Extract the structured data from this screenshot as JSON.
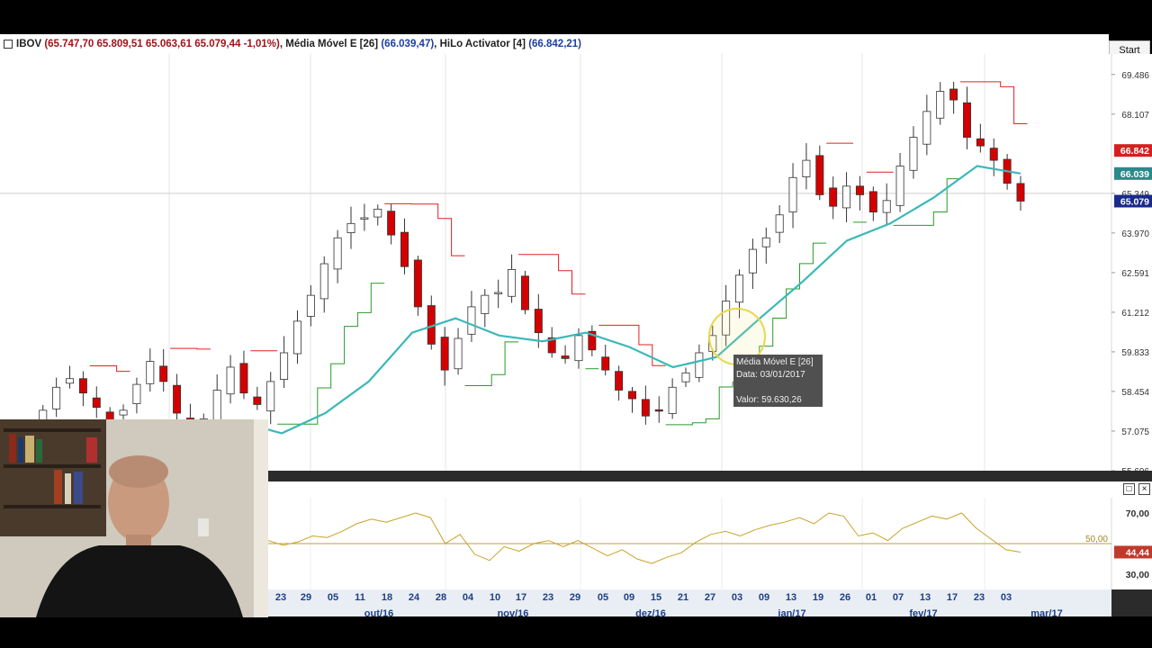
{
  "header": {
    "symbol": "IBOV",
    "ohlc_text": "(65.747,70  65.809,51  65.063,61  65.079,44  -1,01%)",
    "ema_label": "Média Móvel E [26]",
    "ema_value": "(66.039,47)",
    "hilo_label": "HiLo Activator [4]",
    "hilo_value": "(66.842,21)"
  },
  "toolbar": {
    "start_label": "Start"
  },
  "tooltip": {
    "line1": "Média Móvel E [26]",
    "line2": "Data: 03/01/2017",
    "line3": "Valor: 59.630,26"
  },
  "colors": {
    "bull_candle": "#ffffff",
    "bear_candle": "#d40000",
    "ema": "#3cb8b8",
    "hilo_high": "#e02020",
    "hilo_low": "#2a9a2a",
    "indicator": "#c9a227",
    "badge_hilo": "#d42020",
    "badge_ema": "#2a8a8a",
    "badge_last": "#1a2a8a"
  },
  "chart_data": [
    {
      "type": "candlestick",
      "title": "IBOV",
      "y_ticks": [
        "69.486",
        "68.107",
        "65.349",
        "63.970",
        "62.591",
        "61.212",
        "59.833",
        "58.454",
        "57.075",
        "55.696"
      ],
      "ylim": [
        55696,
        70200
      ],
      "badges": [
        {
          "name": "HiLo Activator [4]",
          "text": "66.842",
          "value": 66842
        },
        {
          "name": "Média Móvel E [26]",
          "text": "66.039",
          "value": 66039
        },
        {
          "name": "IBOV",
          "text": "65.079",
          "value": 65079
        }
      ],
      "x_day_labels": [
        "23",
        "29",
        "05",
        "11",
        "18",
        "24",
        "28",
        "04",
        "10",
        "17",
        "23",
        "29",
        "05",
        "09",
        "15",
        "21",
        "27",
        "03",
        "09",
        "13",
        "19",
        "26",
        "01",
        "07",
        "13",
        "17",
        "23",
        "03"
      ],
      "x_month_labels": [
        "out/16",
        "nov/16",
        "dez/16",
        "jan/17",
        "fev/17",
        "mar/17"
      ],
      "ema_anchor_values": [
        56600,
        56900,
        57300,
        57400,
        57000,
        57700,
        58800,
        60500,
        61000,
        60400,
        60200,
        60500,
        60000,
        59300,
        59650,
        61000,
        62300,
        63700,
        64300,
        65200,
        66300,
        66039
      ],
      "series": [
        {
          "name": "IBOV",
          "type": "candlestick",
          "closes": [
            56900,
            57200,
            57800,
            58600,
            58900,
            58400,
            57900,
            57400,
            57800,
            58700,
            59500,
            58800,
            57700,
            57300,
            57500,
            58500,
            59300,
            58400,
            58000,
            58800,
            59800,
            60900,
            61800,
            62900,
            63800,
            64300,
            64500,
            64800,
            63900,
            62800,
            61400,
            60100,
            59200,
            60300,
            61400,
            61800,
            61900,
            62700,
            61300,
            60500,
            59800,
            59600,
            60400,
            59900,
            59200,
            58500,
            58200,
            57600,
            57800,
            58600,
            59100,
            59800,
            60400,
            61600,
            62500,
            63400,
            63800,
            64600,
            65900,
            66500,
            65300,
            64900,
            65600,
            65300,
            64700,
            65100,
            66300,
            67300,
            68200,
            68900,
            68600,
            67300,
            67000,
            66500,
            65700,
            65079
          ]
        },
        {
          "name": "HiLo Activator [4]",
          "type": "step",
          "values": [
            66842
          ]
        },
        {
          "name": "Média Móvel E [26]",
          "type": "line",
          "values": [
            66039
          ]
        }
      ]
    },
    {
      "type": "line",
      "y_ticks": [
        "70,00",
        "50,00",
        "30,00"
      ],
      "ylim": [
        20,
        80
      ],
      "reference_line": {
        "label": "50,00",
        "value": 50
      },
      "badge": {
        "text": "44,44",
        "value": 44.44
      },
      "series": [
        {
          "name": "",
          "values": [
            52,
            49,
            51,
            55,
            54,
            58,
            63,
            66,
            64,
            67,
            70,
            67,
            50,
            56,
            43,
            39,
            48,
            45,
            50,
            52,
            48,
            52,
            47,
            42,
            46,
            40,
            37,
            41,
            44,
            51,
            56,
            58,
            55,
            59,
            62,
            64,
            67,
            63,
            70,
            68,
            55,
            57,
            52,
            60,
            64,
            68,
            66,
            70,
            60,
            53,
            46,
            44.44
          ]
        }
      ]
    }
  ]
}
